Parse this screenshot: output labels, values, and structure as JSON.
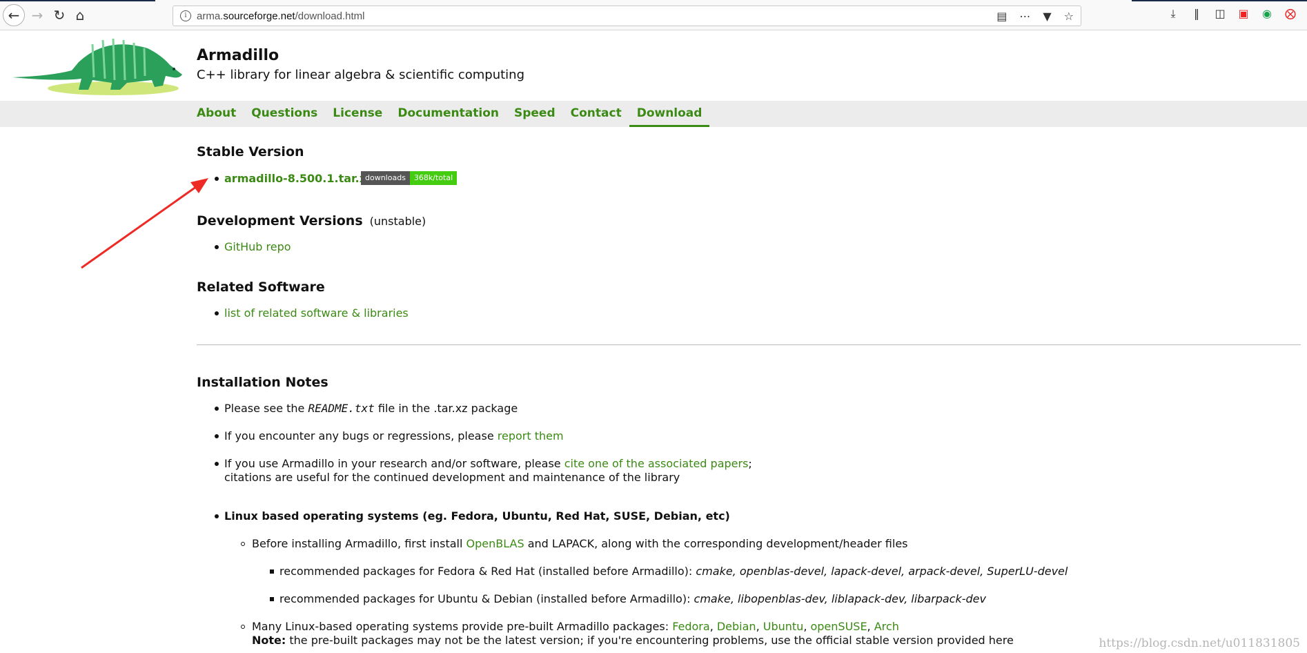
{
  "browser": {
    "url_prefix": "arma.",
    "url_domain": "sourceforge.net",
    "url_path": "/download.html"
  },
  "site": {
    "title": "Armadillo",
    "subtitle": "C++ library for linear algebra & scientific computing"
  },
  "nav": {
    "items": [
      "About",
      "Questions",
      "License",
      "Documentation",
      "Speed",
      "Contact",
      "Download"
    ],
    "active": "Download"
  },
  "stable": {
    "heading": "Stable Version",
    "link": "armadillo-8.500.1.tar.xz",
    "badge_label": "downloads",
    "badge_value": "368k/total"
  },
  "dev": {
    "heading": "Development Versions",
    "note": "(unstable)",
    "link": "GitHub repo"
  },
  "related": {
    "heading": "Related Software",
    "link": "list of related software & libraries"
  },
  "install": {
    "heading": "Installation Notes",
    "readme_pre": "Please see the ",
    "readme_file": "README.txt",
    "readme_post": " file in the .tar.xz package",
    "bugs_pre": "If you encounter any bugs or regressions, please ",
    "bugs_link": "report them",
    "cite_pre": "If you use Armadillo in your research and/or software, please ",
    "cite_link": "cite one of the associated papers",
    "cite_post": ";",
    "cite_line2": "citations are useful for the continued development and maintenance of the library",
    "linux_heading": "Linux based operating systems (eg. Fedora, Ubuntu, Red Hat, SUSE, Debian, etc)",
    "before_pre": "Before installing Armadillo, first install ",
    "before_link": "OpenBLAS",
    "before_post": " and LAPACK, along with the corresponding development/header files",
    "fedora_pre": "recommended packages for Fedora & Red Hat (installed before Armadillo): ",
    "fedora_pkgs": "cmake, openblas-devel, lapack-devel, arpack-devel, SuperLU-devel",
    "ubuntu_pre": "recommended packages for Ubuntu & Debian (installed before Armadillo): ",
    "ubuntu_pkgs": "cmake, libopenblas-dev, liblapack-dev, libarpack-dev",
    "prebuilt_pre": "Many Linux-based operating systems provide pre-built Armadillo packages: ",
    "distros": [
      "Fedora",
      "Debian",
      "Ubuntu",
      "openSUSE",
      "Arch"
    ],
    "note_label": "Note:",
    "note_text": " the pre-built packages may not be the latest version; if you're encountering problems, use the official stable version provided here"
  },
  "watermark": "https://blog.csdn.net/u011831805",
  "colors": {
    "link_green": "#3b8a14",
    "annotation_arrow": "#ee2a24",
    "badge_green": "#44cc11"
  }
}
